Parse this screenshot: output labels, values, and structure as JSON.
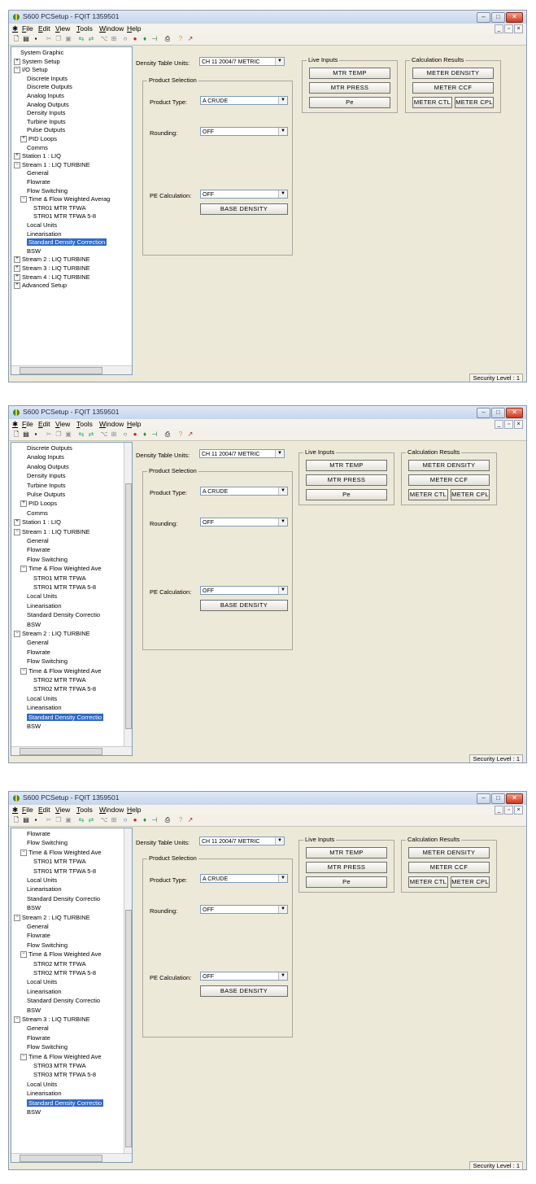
{
  "screens": [
    {
      "title": "S600 PCSetup - FQIT 1359501",
      "menu": [
        "File",
        "Edit",
        "View",
        "Tools",
        "Window",
        "Help"
      ],
      "tree": [
        {
          "label": "System Graphic",
          "indent": 1
        },
        {
          "label": "System Setup",
          "indent": 0,
          "exp": "+"
        },
        {
          "label": "I/O Setup",
          "indent": 0,
          "exp": "−"
        },
        {
          "label": "Discrete Inputs",
          "indent": 2
        },
        {
          "label": "Discrete Outputs",
          "indent": 2
        },
        {
          "label": "Analog Inputs",
          "indent": 2
        },
        {
          "label": "Analog Outputs",
          "indent": 2
        },
        {
          "label": "Density Inputs",
          "indent": 2
        },
        {
          "label": "Turbine Inputs",
          "indent": 2
        },
        {
          "label": "Pulse Outputs",
          "indent": 2
        },
        {
          "label": "PID Loops",
          "indent": 1,
          "exp": "+"
        },
        {
          "label": "Comms",
          "indent": 2
        },
        {
          "label": "Station 1 : LIQ",
          "indent": 0,
          "exp": "+"
        },
        {
          "label": "Stream 1 : LIQ TURBINE",
          "indent": 0,
          "exp": "−"
        },
        {
          "label": "General",
          "indent": 2
        },
        {
          "label": "Flowrate",
          "indent": 2
        },
        {
          "label": "Flow Switching",
          "indent": 2
        },
        {
          "label": "Time & Flow Weighted Averag",
          "indent": 1,
          "exp": "−"
        },
        {
          "label": "STR01 MTR TFWA",
          "indent": 3
        },
        {
          "label": "STR01 MTR TFWA 5-8",
          "indent": 3
        },
        {
          "label": "Local Units",
          "indent": 2
        },
        {
          "label": "Linearisation",
          "indent": 2
        },
        {
          "label": "Standard Density Correction",
          "indent": 2,
          "selected": true
        },
        {
          "label": "BSW",
          "indent": 2
        },
        {
          "label": "Stream 2 : LIQ TURBINE",
          "indent": 0,
          "exp": "+"
        },
        {
          "label": "Stream 3 : LIQ TURBINE",
          "indent": 0,
          "exp": "+"
        },
        {
          "label": "Stream 4 : LIQ TURBINE",
          "indent": 0,
          "exp": "+"
        },
        {
          "label": "Advanced Setup",
          "indent": 0,
          "exp": "+"
        }
      ],
      "density_units_label": "Density Table Units:",
      "density_units_value": "CH 11 2004/7 METRIC",
      "product_selection": "Product Selection",
      "product_type_label": "Product Type:",
      "product_type_value": "A CRUDE",
      "rounding_label": "Rounding:",
      "rounding_value": "OFF",
      "pe_calc_label": "PE Calculation:",
      "pe_calc_value": "OFF",
      "base_density": "BASE DENSITY",
      "live_inputs": "Live Inputs",
      "mtr_temp": "MTR TEMP",
      "mtr_press": "MTR PRESS",
      "pe": "Pe",
      "calc_results": "Calculation Results",
      "meter_density": "METER DENSITY",
      "meter_ccf": "METER CCF",
      "meter_ctl": "METER CTL",
      "meter_cpl": "METER CPL",
      "security_level": "Security Level : 1"
    },
    {
      "title": "S600 PCSetup - FQIT 1359501",
      "menu": [
        "File",
        "Edit",
        "View",
        "Tools",
        "Window",
        "Help"
      ],
      "tree": [
        {
          "label": "Discrete Outputs",
          "indent": 2
        },
        {
          "label": "Analog Inputs",
          "indent": 2
        },
        {
          "label": "Analog Outputs",
          "indent": 2
        },
        {
          "label": "Density Inputs",
          "indent": 2
        },
        {
          "label": "Turbine Inputs",
          "indent": 2
        },
        {
          "label": "Pulse Outputs",
          "indent": 2
        },
        {
          "label": "PID Loops",
          "indent": 1,
          "exp": "+"
        },
        {
          "label": "Comms",
          "indent": 2
        },
        {
          "label": "Station 1 : LIQ",
          "indent": 0,
          "exp": "+"
        },
        {
          "label": "Stream 1 : LIQ TURBINE",
          "indent": 0,
          "exp": "−"
        },
        {
          "label": "General",
          "indent": 2
        },
        {
          "label": "Flowrate",
          "indent": 2
        },
        {
          "label": "Flow Switching",
          "indent": 2
        },
        {
          "label": "Time & Flow Weighted Ave",
          "indent": 1,
          "exp": "−"
        },
        {
          "label": "STR01 MTR TFWA",
          "indent": 3
        },
        {
          "label": "STR01 MTR TFWA 5-8",
          "indent": 3
        },
        {
          "label": "Local Units",
          "indent": 2
        },
        {
          "label": "Linearisation",
          "indent": 2
        },
        {
          "label": "Standard Density Correctio",
          "indent": 2
        },
        {
          "label": "BSW",
          "indent": 2
        },
        {
          "label": "Stream 2 : LIQ TURBINE",
          "indent": 0,
          "exp": "−"
        },
        {
          "label": "General",
          "indent": 2
        },
        {
          "label": "Flowrate",
          "indent": 2
        },
        {
          "label": "Flow Switching",
          "indent": 2
        },
        {
          "label": "Time & Flow Weighted Ave",
          "indent": 1,
          "exp": "−"
        },
        {
          "label": "STR02 MTR TFWA",
          "indent": 3
        },
        {
          "label": "STR02 MTR TFWA 5-8",
          "indent": 3
        },
        {
          "label": "Local Units",
          "indent": 2
        },
        {
          "label": "Linearisation",
          "indent": 2
        },
        {
          "label": "Standard Density Correctio",
          "indent": 2,
          "selected": true
        },
        {
          "label": "BSW",
          "indent": 2
        }
      ],
      "density_units_label": "Density Table Units:",
      "density_units_value": "CH 11 2004/7 METRIC",
      "product_selection": "Product Selection",
      "product_type_label": "Product Type:",
      "product_type_value": "A CRUDE",
      "rounding_label": "Rounding:",
      "rounding_value": "OFF",
      "pe_calc_label": "PE Calculation:",
      "pe_calc_value": "OFF",
      "base_density": "BASE DENSITY",
      "live_inputs": "Live Inputs",
      "mtr_temp": "MTR TEMP",
      "mtr_press": "MTR PRESS",
      "pe": "Pe",
      "calc_results": "Calculation Results",
      "meter_density": "METER DENSITY",
      "meter_ccf": "METER CCF",
      "meter_ctl": "METER CTL",
      "meter_cpl": "METER CPL",
      "security_level": "Security Level : 1"
    },
    {
      "title": "S600 PCSetup - FQIT 1359501",
      "menu": [
        "File",
        "Edit",
        "View",
        "Tools",
        "Window",
        "Help"
      ],
      "tree": [
        {
          "label": "Flowrate",
          "indent": 2
        },
        {
          "label": "Flow Switching",
          "indent": 2
        },
        {
          "label": "Time & Flow Weighted Ave",
          "indent": 1,
          "exp": "−"
        },
        {
          "label": "STR01 MTR TFWA",
          "indent": 3
        },
        {
          "label": "STR01 MTR TFWA 5-8",
          "indent": 3
        },
        {
          "label": "Local Units",
          "indent": 2
        },
        {
          "label": "Linearisation",
          "indent": 2
        },
        {
          "label": "Standard Density Correctio",
          "indent": 2
        },
        {
          "label": "BSW",
          "indent": 2
        },
        {
          "label": "Stream 2 : LIQ TURBINE",
          "indent": 0,
          "exp": "−"
        },
        {
          "label": "General",
          "indent": 2
        },
        {
          "label": "Flowrate",
          "indent": 2
        },
        {
          "label": "Flow Switching",
          "indent": 2
        },
        {
          "label": "Time & Flow Weighted Ave",
          "indent": 1,
          "exp": "−"
        },
        {
          "label": "STR02 MTR TFWA",
          "indent": 3
        },
        {
          "label": "STR02 MTR TFWA 5-8",
          "indent": 3
        },
        {
          "label": "Local Units",
          "indent": 2
        },
        {
          "label": "Linearisation",
          "indent": 2
        },
        {
          "label": "Standard Density Correctio",
          "indent": 2
        },
        {
          "label": "BSW",
          "indent": 2
        },
        {
          "label": "Stream 3 : LIQ TURBINE",
          "indent": 0,
          "exp": "−"
        },
        {
          "label": "General",
          "indent": 2
        },
        {
          "label": "Flowrate",
          "indent": 2
        },
        {
          "label": "Flow Switching",
          "indent": 2
        },
        {
          "label": "Time & Flow Weighted Ave",
          "indent": 1,
          "exp": "−"
        },
        {
          "label": "STR03 MTR TFWA",
          "indent": 3
        },
        {
          "label": "STR03 MTR TFWA 5-8",
          "indent": 3
        },
        {
          "label": "Local Units",
          "indent": 2
        },
        {
          "label": "Linearisation",
          "indent": 2
        },
        {
          "label": "Standard Density Correctio",
          "indent": 2,
          "selected": true
        },
        {
          "label": "BSW",
          "indent": 2
        }
      ],
      "density_units_label": "Density Table Units:",
      "density_units_value": "CH 11 2004/7 METRIC",
      "product_selection": "Product Selection",
      "product_type_label": "Product Type:",
      "product_type_value": "A CRUDE",
      "rounding_label": "Rounding:",
      "rounding_value": "OFF",
      "pe_calc_label": "PE Calculation:",
      "pe_calc_value": "OFF",
      "base_density": "BASE DENSITY",
      "live_inputs": "Live Inputs",
      "mtr_temp": "MTR TEMP",
      "mtr_press": "MTR PRESS",
      "pe": "Pe",
      "calc_results": "Calculation Results",
      "meter_density": "METER DENSITY",
      "meter_ccf": "METER CCF",
      "meter_ctl": "METER CTL",
      "meter_cpl": "METER CPL",
      "security_level": "Security Level : 1"
    }
  ]
}
